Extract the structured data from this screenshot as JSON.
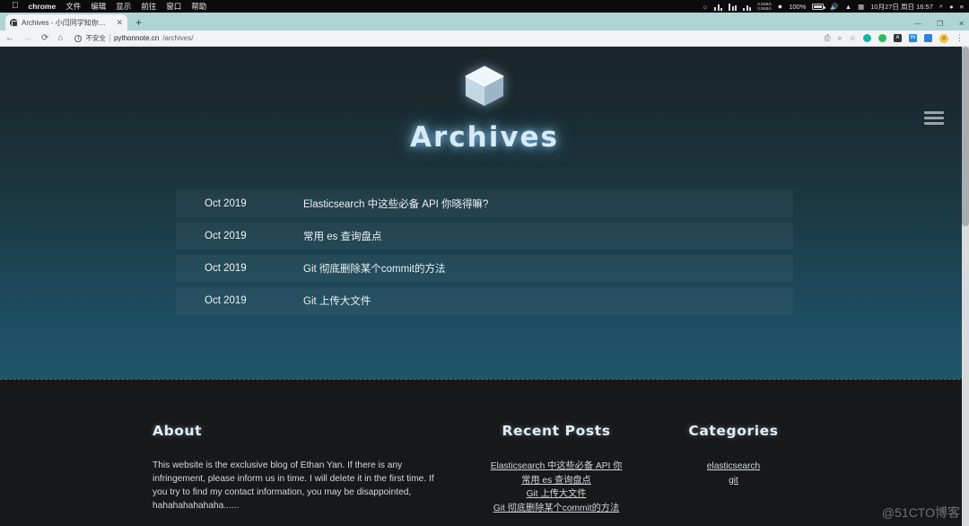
{
  "os_menubar": {
    "apple_logo": "",
    "items": [
      "chrome",
      "文件",
      "编辑",
      "显示",
      "前往",
      "窗口",
      "帮助"
    ],
    "net_up": "0.0KB/s",
    "net_down": "0.0KB/s",
    "battery_percent": "100%",
    "input_method": "拼音",
    "datetime": "10月27日 周日 16:57"
  },
  "browser": {
    "tab": {
      "title": "Archives - 小闫同学知你多嘿的",
      "close_label": "✕"
    },
    "new_tab_label": "+",
    "window_controls": {
      "minimize": "—",
      "maximize": "❐",
      "close": "✕"
    },
    "nav": {
      "back": "←",
      "forward": "→",
      "reload": "⟳",
      "home": "⌂"
    },
    "omnibox": {
      "info_glyph": "ⓘ",
      "security_label": "不安全",
      "url_host": "pythonnote.cn",
      "url_path": "/archives/"
    },
    "toolbar_icons": [
      {
        "name": "translate-icon",
        "glyph": "⎙"
      },
      {
        "name": "zoom-icon",
        "glyph": "⌕"
      },
      {
        "name": "bookmark-star-icon",
        "glyph": "☆"
      }
    ],
    "extensions": [
      {
        "name": "extension-teal",
        "color": "#16b3a7",
        "glyph": ""
      },
      {
        "name": "extension-green",
        "color": "#2bbd5c",
        "glyph": ""
      },
      {
        "name": "extension-dark",
        "color": "#2f3337",
        "glyph": "A"
      },
      {
        "name": "extension-blue-in",
        "color": "#1f8ae0",
        "glyph": "IN"
      },
      {
        "name": "extension-blue-chat",
        "color": "#2f7fe0",
        "glyph": ""
      }
    ],
    "avatar_glyph": "☺",
    "menu_glyph": "⋮"
  },
  "page": {
    "logo_name": "cube-logo",
    "title": "Archives",
    "menu_toggle": "hamburger-menu",
    "archives": [
      {
        "date": "Oct 2019",
        "title": "Elasticsearch 中这些必备 API 你晓得嘛?"
      },
      {
        "date": "Oct 2019",
        "title": "常用 es 查询盘点"
      },
      {
        "date": "Oct 2019",
        "title": "Git 彻底删除某个commit的方法"
      },
      {
        "date": "Oct 2019",
        "title": "Git 上传大文件"
      }
    ],
    "footer": {
      "about": {
        "heading": "About",
        "text": "This website is the exclusive blog of Ethan Yan. If there is any infringement, please inform us in time. I will delete it in the first time. If you try to find my contact information, you may be disappointed, hahahahahahaha......"
      },
      "recent": {
        "heading": "Recent Posts",
        "links": [
          "Elasticsearch 中这些必备 API 你",
          "常用 es 查询盘点",
          "Git 上传大文件",
          "Git 彻底删除某个commit的方法"
        ]
      },
      "categories": {
        "heading": "Categories",
        "links": [
          "elasticsearch",
          "git"
        ]
      }
    },
    "watermark": "@51CTO博客"
  },
  "colors": {
    "hero_top": "#1a2529",
    "hero_bottom": "#1e5569",
    "footer_bg": "#17181a",
    "tabstrip_bg": "#aed5d2",
    "accent_glow": "#96d2ff"
  }
}
